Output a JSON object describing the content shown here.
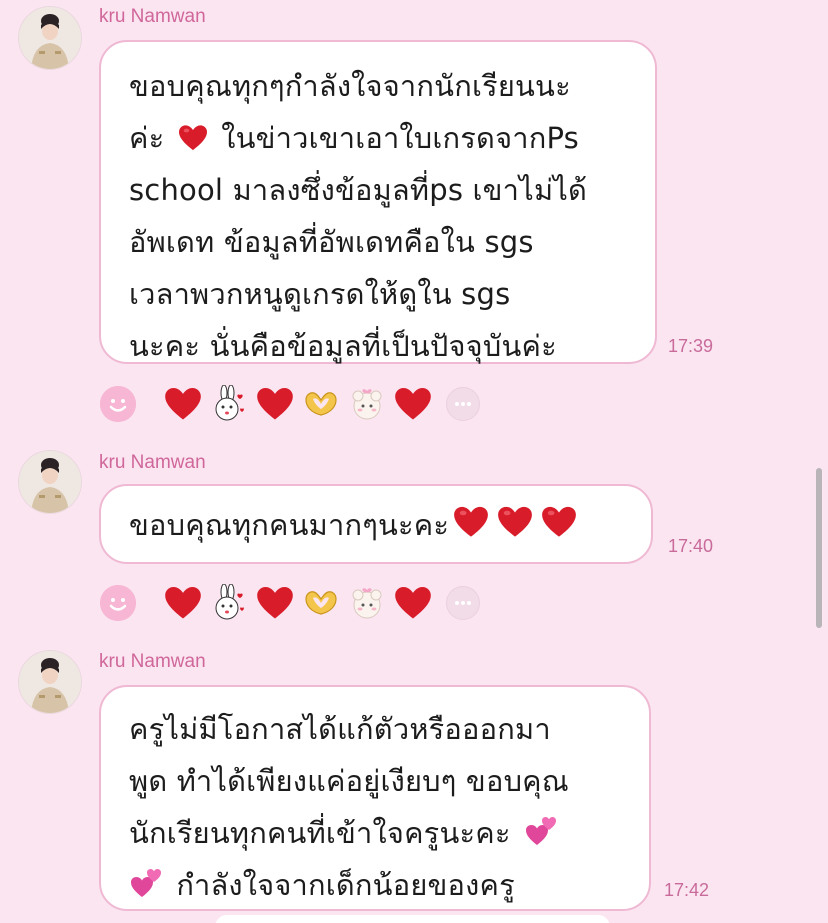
{
  "colors": {
    "background": "#fbe5f1",
    "bubble_border": "#efb9d3",
    "sender": "#d0679a",
    "time": "#c86b9a",
    "heart": "#d91c2a"
  },
  "messages": [
    {
      "sender": "kru Namwan",
      "lines": [
        "ขอบคุณทุกๆกำลังใจจากนักเรียนนะ",
        "ค่ะ ",
        "school มาลงซึ่งข้อมูลที่ps เขาไม่ได้",
        "อัพเดท ข้อมูลที่อัพเดทคือใน sgs",
        "เวลาพวกหนูดูเกรดให้ดูใน sgs",
        "นะคะ นั่นคือข้อมูลที่เป็นปัจจุบันค่ะ"
      ],
      "line2_tail": " ในข่าวเขาเอาใบเกรดจากPs",
      "time": "17:39",
      "reactions": [
        "heart",
        "bunny-sticker",
        "heart",
        "heart-hands",
        "sheep-sticker",
        "heart"
      ]
    },
    {
      "sender": "kru Namwan",
      "lines": [
        "ขอบคุณทุกคนมากๆนะคะ"
      ],
      "time": "17:40",
      "reactions": [
        "heart",
        "bunny-sticker",
        "heart",
        "heart-hands",
        "sheep-sticker",
        "heart"
      ]
    },
    {
      "sender": "kru Namwan",
      "lines": [
        "ครูไม่มีโอกาสได้แก้ตัวหรือออกมา",
        "พูด ทำได้เพียงแค่อยู่เงียบๆ ขอบคุณ",
        "นักเรียนทุกคนที่เข้าใจครูนะคะ ",
        " กำลังใจจากเด็กน้อยของครู"
      ],
      "time": "17:42"
    }
  ]
}
